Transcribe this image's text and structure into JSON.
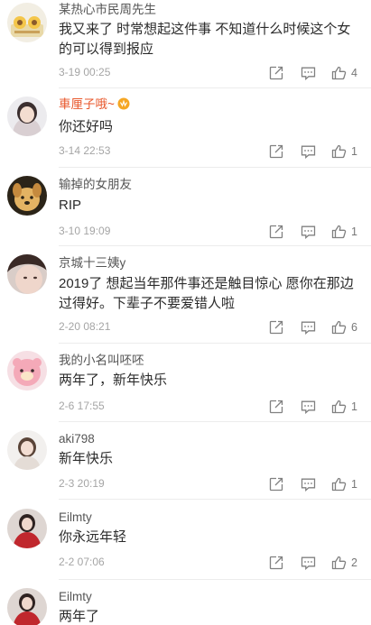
{
  "comments": [
    {
      "user": "某热心市民周先生",
      "text": "我又来了 时常想起这件事 不知道什么时候这个女的可以得到报应",
      "time": "3-19 00:25",
      "likes": "4",
      "avatar": "cartoon-avatar"
    },
    {
      "user": "車厘子哦~",
      "text": "你还好吗",
      "time": "3-14 22:53",
      "likes": "1",
      "avatar": "girl-light-avatar",
      "badge": "vip-badge-icon"
    },
    {
      "user": "输掉的女朋友",
      "text": "RIP",
      "time": "3-10 19:09",
      "likes": "1",
      "avatar": "dog-avatar"
    },
    {
      "user": "京城十三姨y",
      "text": "2019了 想起当年那件事还是触目惊心 愿你在那边过得好。下辈子不要爱错人啦",
      "time": "2-20 08:21",
      "likes": "6",
      "avatar": "girl-closeup-avatar"
    },
    {
      "user": "我的小名叫呸呸",
      "text": "两年了，新年快乐",
      "time": "2-6 17:55",
      "likes": "1",
      "avatar": "pink-toy-avatar"
    },
    {
      "user": "aki798",
      "text": "新年快乐",
      "time": "2-3 20:19",
      "likes": "1",
      "avatar": "girl-white-avatar"
    },
    {
      "user": "Eilmty",
      "text": "你永远年轻",
      "time": "2-2 07:06",
      "likes": "2",
      "avatar": "red-dress-avatar"
    },
    {
      "user": "Eilmty",
      "text": "两年了",
      "time": "",
      "likes": "",
      "avatar": "red-dress-avatar"
    }
  ]
}
